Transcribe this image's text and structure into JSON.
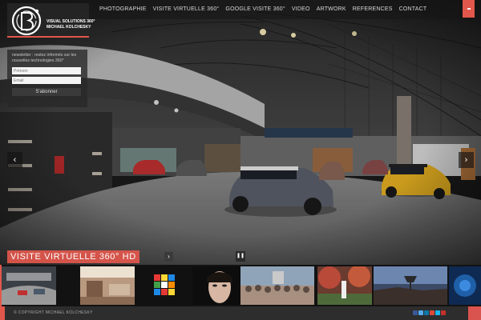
{
  "brand": {
    "line1": "VISUAL SOLUTIONS 360°",
    "line2": "MICHAEL KOLCHESKY",
    "accent_color": "#e2574c"
  },
  "nav": {
    "items": [
      {
        "label": "PHOTOGRAPHIE"
      },
      {
        "label": "VISITE VIRTUELLE 360°"
      },
      {
        "label": "GOOGLE VISITE 360°"
      },
      {
        "label": "VIDEO"
      },
      {
        "label": "ARTWORK"
      },
      {
        "label": "REFERENCES"
      },
      {
        "label": "CONTACT"
      }
    ],
    "menu_icon": "menu-icon"
  },
  "newsletter": {
    "text": "newsletter : restez informés sur les nouvelles technologies 360°",
    "firstname_placeholder": "Prénom",
    "email_placeholder": "Email",
    "submit_label": "S'abonner"
  },
  "slider": {
    "title": "VISITE VIRTUELLE 360° HD",
    "prev_icon": "chevron-left-icon",
    "next_icon": "chevron-right-icon",
    "pause_icon": "pause-icon"
  },
  "thumbnails": [
    {
      "name": "showroom-thumb"
    },
    {
      "name": "interior-thumb"
    },
    {
      "name": "rubiks-cube-thumb"
    },
    {
      "name": "face-thumb"
    },
    {
      "name": "crowd-thumb"
    },
    {
      "name": "garden-thumb"
    },
    {
      "name": "landscape-thumb"
    },
    {
      "name": "blue-thumb"
    }
  ],
  "footer": {
    "copyright": "© COPYRIGHT MICHAEL KOLCHESKY",
    "social_icons": [
      "facebook-icon",
      "twitter-icon",
      "linkedin-icon",
      "google-plus-icon",
      "vimeo-icon",
      "youtube-icon"
    ]
  }
}
